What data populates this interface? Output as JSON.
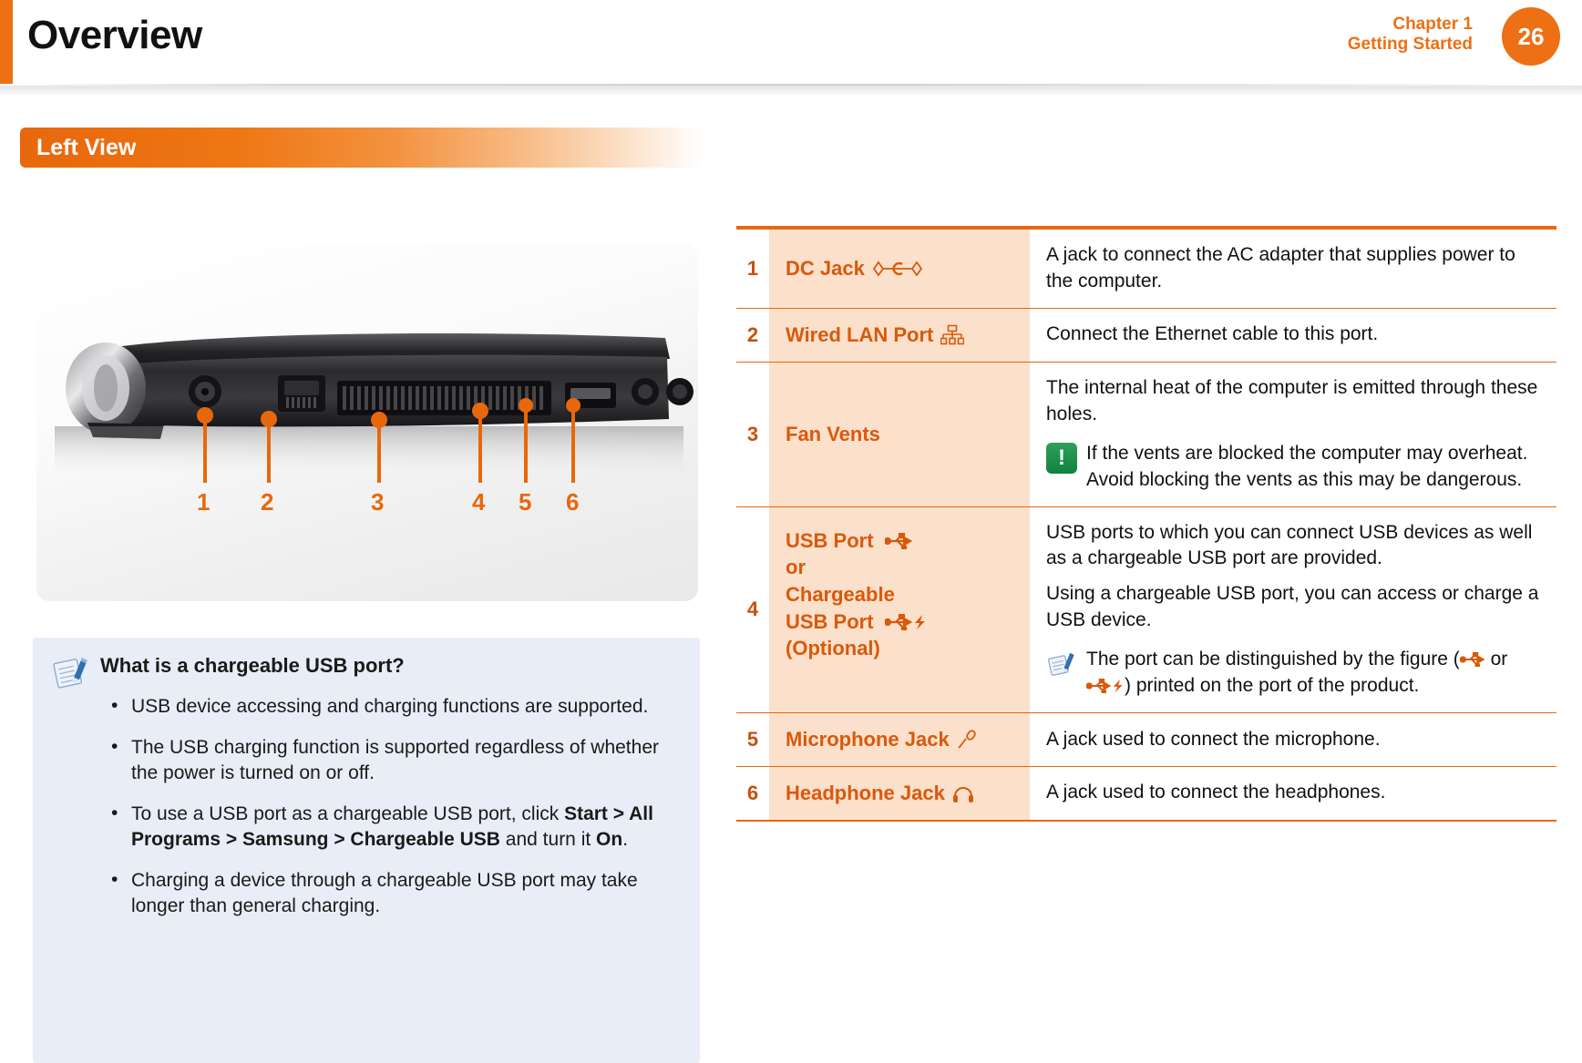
{
  "header": {
    "title": "Overview",
    "chapter_line1": "Chapter 1",
    "chapter_line2": "Getting Started",
    "page_number": "26"
  },
  "section": {
    "title": "Left View"
  },
  "figure": {
    "callouts": [
      "1",
      "2",
      "3",
      "4",
      "5",
      "6"
    ]
  },
  "note": {
    "icon": "note-pencil-icon",
    "title": "What is a chargeable USB port?",
    "bullet_marker": "•",
    "items": [
      {
        "plain": "USB device accessing and charging functions are supported."
      },
      {
        "plain": "The USB charging function is supported regardless of whether the power is turned on or off."
      },
      {
        "rich": true,
        "pre": "To use a USB port as a chargeable USB port, click ",
        "bold": "Start > All Programs > Samsung > Chargeable USB",
        "mid": " and turn it ",
        "bold2": "On",
        "post": "."
      },
      {
        "plain": "Charging a device through a chargeable USB port may take longer than general charging."
      }
    ]
  },
  "table": {
    "rows": [
      {
        "num": "1",
        "name": "DC Jack",
        "name_icon": "dc-jack-icon",
        "desc": [
          "A jack to connect the AC adapter that supplies power to the computer."
        ]
      },
      {
        "num": "2",
        "name": "Wired LAN Port",
        "name_icon": "wired-lan-icon",
        "desc": [
          "Connect the Ethernet cable to this port."
        ]
      },
      {
        "num": "3",
        "name": "Fan Vents",
        "name_icon": "",
        "desc": [
          "The internal heat of the computer is emitted through these holes."
        ],
        "warning": {
          "icon": "warning-exclamation-icon",
          "badge_char": "!",
          "text": "If the vents are blocked the computer may overheat. Avoid blocking the vents as this may be dangerous."
        }
      },
      {
        "num": "4",
        "name_line1": "USB Port",
        "name_line1_icon": "usb-icon",
        "name_line2": "or",
        "name_line3": "Chargeable",
        "name_line4": "USB Port",
        "name_line4_icon": "usb-charge-icon",
        "name_line5": "(Optional)",
        "desc": [
          "USB ports to which you can connect USB devices as well as a chargeable USB port are provided.",
          "Using a chargeable USB port, you can access or charge a USB device."
        ],
        "note": {
          "icon": "note-pencil-icon",
          "pre": "The port can be distinguished by the figure (",
          "mid": " or ",
          "post": ") printed on the port of the product."
        }
      },
      {
        "num": "5",
        "name": "Microphone Jack",
        "name_icon": "microphone-icon",
        "desc": [
          "A jack used to connect the microphone."
        ]
      },
      {
        "num": "6",
        "name": "Headphone Jack",
        "name_icon": "headphone-icon",
        "desc": [
          "A jack used to connect the headphones."
        ]
      }
    ]
  },
  "colors": {
    "accent_orange": "#ED7014",
    "deep_orange": "#E8670C",
    "name_cell_bg": "#FBE0CB",
    "name_text": "#D9590B",
    "note_box_bg": "#E9EDF7",
    "warning_green": "#108240"
  }
}
